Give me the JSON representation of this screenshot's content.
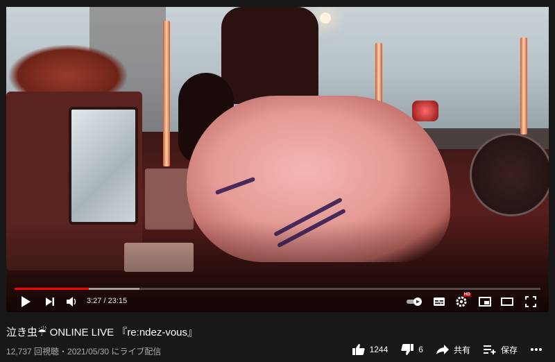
{
  "video": {
    "progress_fraction": 0.141,
    "buffered_fraction": 0.237,
    "current_time": "3:27",
    "duration": "23:15",
    "time_display": "3:27 / 23:15",
    "hd_badge": "HD"
  },
  "info": {
    "title": "泣き虫☔ ONLINE LIVE 『re:ndez-vous』",
    "views_and_date": "12,737 回視聴・2021/05/30 にライブ配信"
  },
  "actions": {
    "like_count": "1244",
    "dislike_count": "6",
    "share_label": "共有",
    "save_label": "保存"
  },
  "colors": {
    "background": "#181818",
    "progress": "#ff0000"
  },
  "icons": [
    "play-icon",
    "next-icon",
    "volume-icon",
    "autoplay-toggle-icon",
    "subtitles-icon",
    "settings-icon",
    "miniplayer-icon",
    "theater-icon",
    "fullscreen-icon",
    "like-icon",
    "dislike-icon",
    "share-icon",
    "save-icon",
    "more-icon"
  ]
}
